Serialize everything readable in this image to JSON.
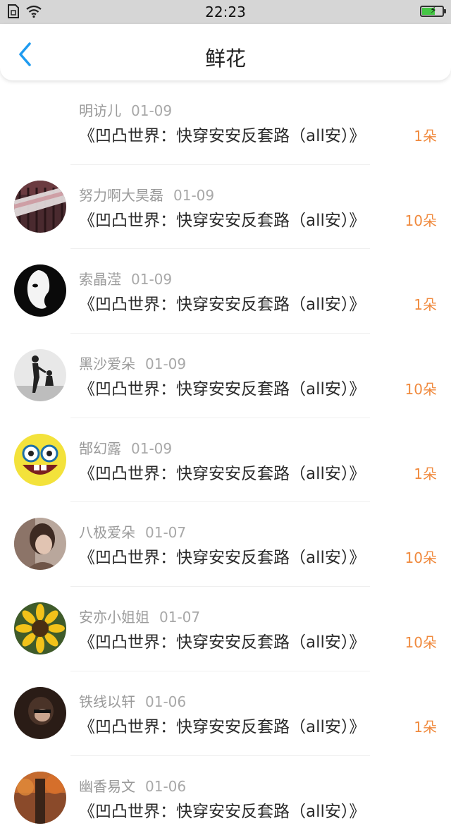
{
  "status_bar": {
    "time": "22:23"
  },
  "header": {
    "title": "鲜花"
  },
  "colors": {
    "accent": "#1e9bf0",
    "flower_count": "#f08a3e"
  },
  "items": [
    {
      "name": "明访儿",
      "date": "01-09",
      "book": "《凹凸世界：快穿安安反套路（all安）》",
      "flowers": "1朵",
      "avatar": "none"
    },
    {
      "name": "努力啊大昊磊",
      "date": "01-09",
      "book": "《凹凸世界：快穿安安反套路（all安）》",
      "flowers": "10朵",
      "avatar": "ribbon-photo"
    },
    {
      "name": "索晶滢",
      "date": "01-09",
      "book": "《凹凸世界：快穿安安反套路（all安）》",
      "flowers": "1朵",
      "avatar": "mask-photo"
    },
    {
      "name": "黑沙爱朵",
      "date": "01-09",
      "book": "《凹凸世界：快穿安安反套路（all安）》",
      "flowers": "10朵",
      "avatar": "silhouette-photo"
    },
    {
      "name": "郜幻露",
      "date": "01-09",
      "book": "《凹凸世界：快穿安安反套路（all安）》",
      "flowers": "1朵",
      "avatar": "cartoon-face"
    },
    {
      "name": "八极爱朵",
      "date": "01-07",
      "book": "《凹凸世界：快穿安安反套路（all安）》",
      "flowers": "10朵",
      "avatar": "girl-photo"
    },
    {
      "name": "安亦小姐姐",
      "date": "01-07",
      "book": "《凹凸世界：快穿安安反套路（all安）》",
      "flowers": "10朵",
      "avatar": "sunflower-photo"
    },
    {
      "name": "铁线以轩",
      "date": "01-06",
      "book": "《凹凸世界：快穿安安反套路（all安）》",
      "flowers": "1朵",
      "avatar": "dark-photo"
    },
    {
      "name": "幽香易文",
      "date": "01-06",
      "book": "《凹凸世界：快穿安安反套路（all安）》",
      "flowers": "",
      "avatar": "autumn-photo"
    }
  ]
}
